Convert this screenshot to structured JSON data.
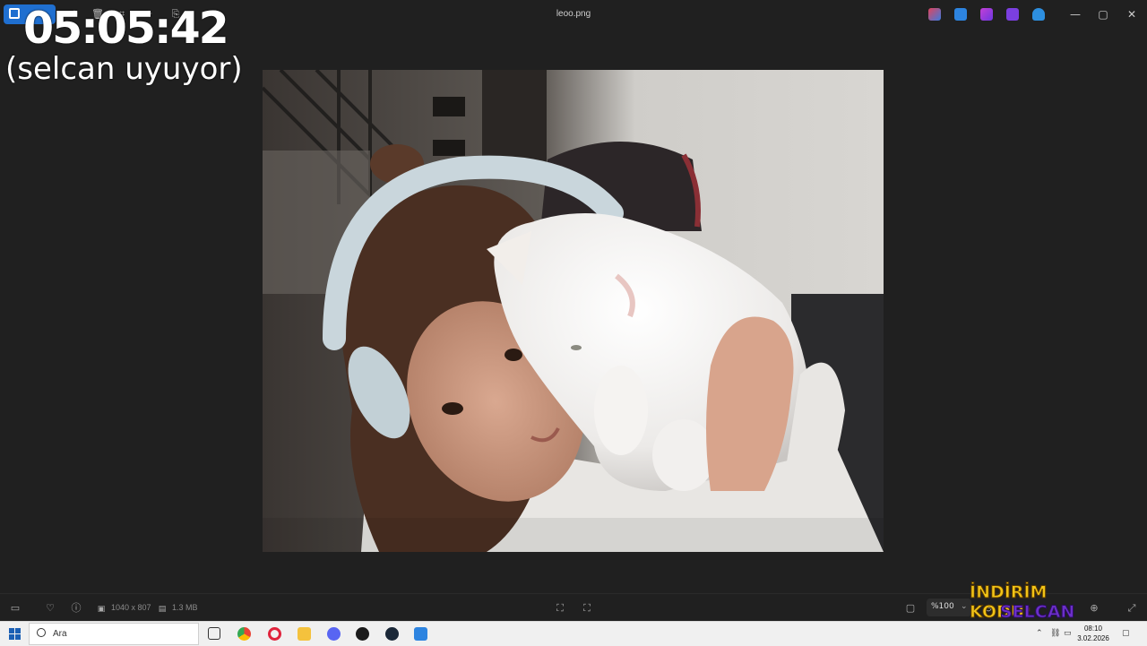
{
  "window": {
    "title": "leoo.png",
    "controls": {
      "minimize": "—",
      "maximize": "▢",
      "close": "✕"
    }
  },
  "overlay": {
    "timer": "05:05:42",
    "subtitle": "(selcan uyuyor)"
  },
  "image_info": {
    "dimensions": "1040 x 807",
    "file_size": "1.3 MB"
  },
  "zoom": {
    "value": "%100"
  },
  "promo": {
    "line1": "İNDİRİM KODU:",
    "line2": "SELCAN"
  },
  "taskbar": {
    "search_placeholder": "Ara",
    "time": "08:10",
    "date": "3.02.2026"
  },
  "colors": {
    "accent": "#1f6fd0",
    "promo_yellow": "#f2c417",
    "promo_purple": "#6c2fc9"
  },
  "icons": {
    "titlebar": [
      "edit-icon",
      "rotate-icon",
      "delete-icon",
      "crop-icon",
      "filter-icon",
      "share-icon"
    ],
    "statusbar": [
      "filmstrip-icon",
      "favorite-icon",
      "info-icon",
      "fit-icon",
      "fullscreen-icon",
      "zoom-out-icon",
      "zoom-in-icon",
      "expand-icon"
    ],
    "taskbar": [
      "start-icon",
      "task-view-icon",
      "chrome-icon",
      "opera-icon",
      "file-explorer-icon",
      "discord-icon",
      "app-icon",
      "steam-icon",
      "photos-icon"
    ]
  }
}
